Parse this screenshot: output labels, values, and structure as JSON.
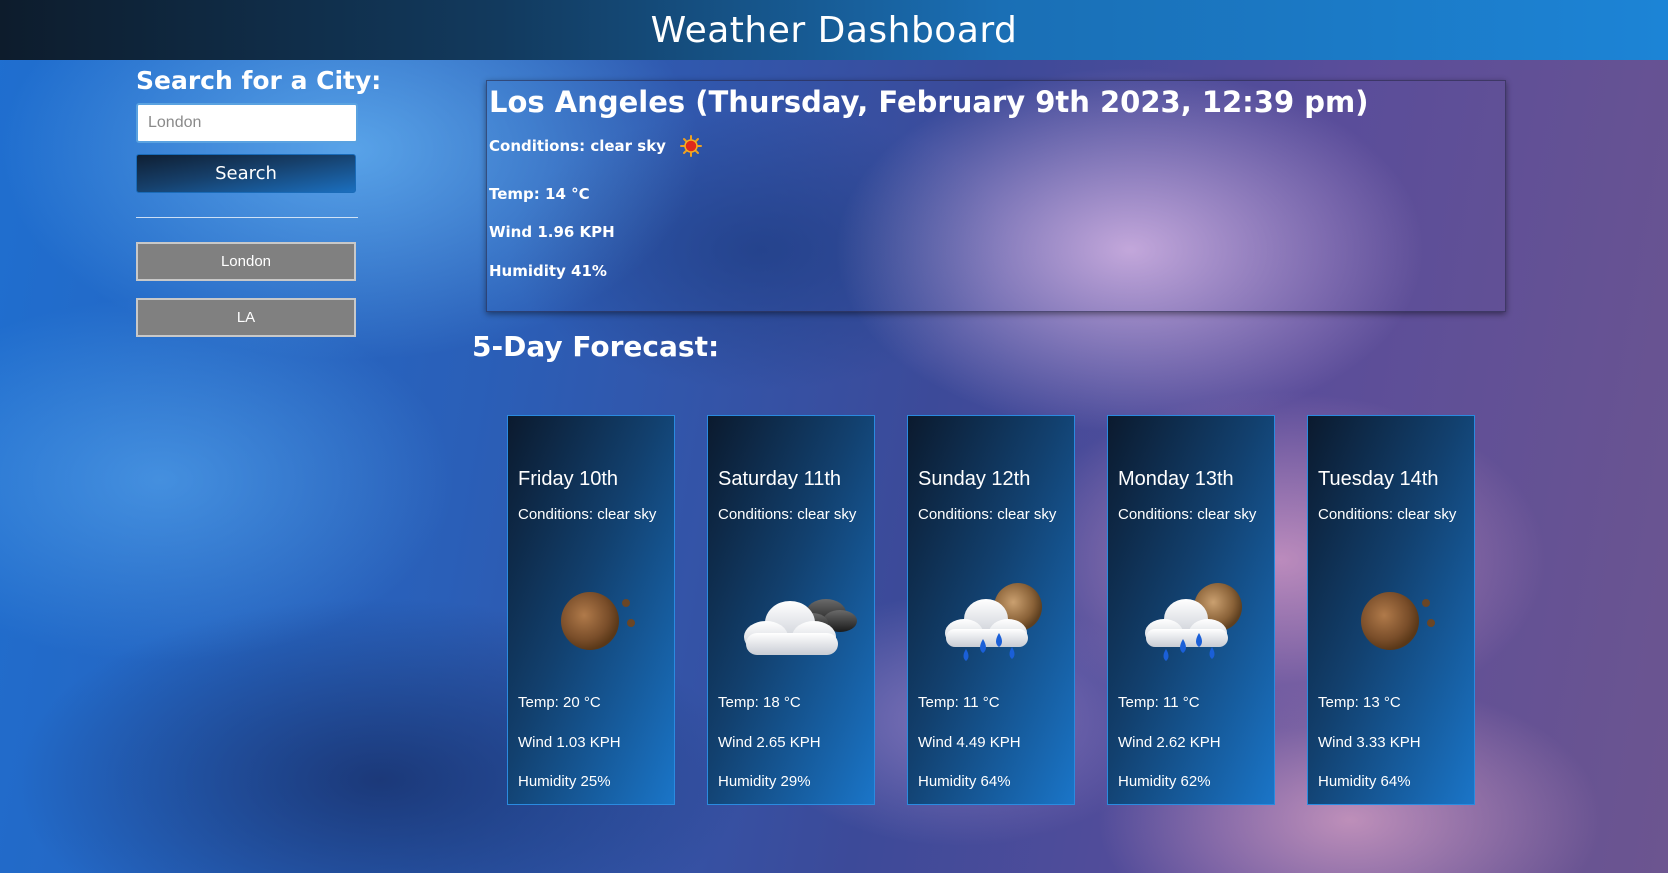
{
  "header": {
    "title": "Weather Dashboard"
  },
  "sidebar": {
    "heading": "Search for a City:",
    "search_placeholder": "London",
    "search_button_label": "Search",
    "history": [
      {
        "label": "London"
      },
      {
        "label": "LA"
      }
    ]
  },
  "current": {
    "title": "Los Angeles (Thursday, February 9th 2023, 12:39 pm)",
    "conditions": "Conditions: clear sky",
    "icon": "clear-sky-sun-icon",
    "temp": "Temp: 14 °C",
    "wind": "Wind 1.96 KPH",
    "humidity": "Humidity 41%"
  },
  "forecast": {
    "heading": "5-Day Forecast:",
    "days": [
      {
        "day": "Friday 10th",
        "conditions": "Conditions: clear sky",
        "icon": "clear-night-moon-icon",
        "temp": "Temp: 20 °C",
        "wind": "Wind 1.03 KPH",
        "humidity": "Humidity 25%"
      },
      {
        "day": "Saturday 11th",
        "conditions": "Conditions: clear sky",
        "icon": "cloud-night-icon",
        "temp": "Temp: 18 °C",
        "wind": "Wind 2.65 KPH",
        "humidity": "Humidity 29%"
      },
      {
        "day": "Sunday 12th",
        "conditions": "Conditions: clear sky",
        "icon": "rain-night-icon",
        "temp": "Temp: 11 °C",
        "wind": "Wind 4.49 KPH",
        "humidity": "Humidity 64%"
      },
      {
        "day": "Monday 13th",
        "conditions": "Conditions: clear sky",
        "icon": "rain-night-icon",
        "temp": "Temp: 11 °C",
        "wind": "Wind 2.62 KPH",
        "humidity": "Humidity 62%"
      },
      {
        "day": "Tuesday 14th",
        "conditions": "Conditions: clear sky",
        "icon": "clear-night-moon-icon",
        "temp": "Temp: 13 °C",
        "wind": "Wind 3.33 KPH",
        "humidity": "Humidity 64%"
      }
    ]
  }
}
